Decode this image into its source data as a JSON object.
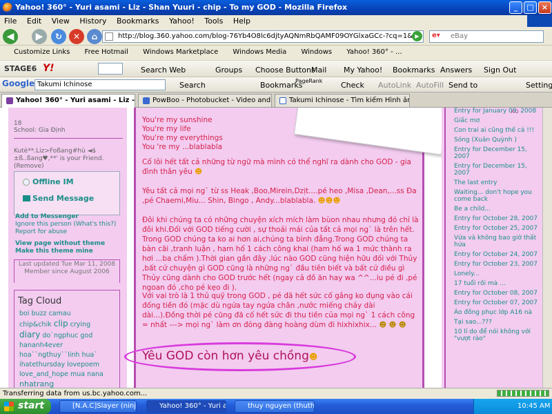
{
  "window": {
    "title": "Yahoo! 360° - Yuri asami - Liz - Shan Yuuri - chip - To my GOD - Mozilla Firefox"
  },
  "menu": [
    "File",
    "Edit",
    "View",
    "History",
    "Bookmarks",
    "Yahoo!",
    "Tools",
    "Help"
  ],
  "nav": {
    "url": "http://blog.360.yahoo.com/blog-76Yb4O8lc6djtyAQNmRbQAMF09OYGlxaGCc-?cq=1&p=140",
    "search_placeholder": "eBay"
  },
  "bookmarks": [
    "Customize Links",
    "Free Hotmail",
    "Windows Marketplace",
    "Windows Media",
    "Windows",
    "Yahoo! 360° - ..."
  ],
  "toolbar1": {
    "brand": "STAGE6",
    "search_web": "Search Web",
    "groups": "Groups",
    "choose_buttons": "Choose Buttons",
    "mail": "Mail",
    "my_yahoo": "My Yahoo!",
    "bookmarks": "Bookmarks",
    "answers": "Answers",
    "sign_out": "Sign Out"
  },
  "toolbar2": {
    "google": "Google",
    "query": "Takumi Ichinose",
    "search": "Search",
    "bookmarks": "Bookmarks",
    "pagerank": "PageRank",
    "check": "Check",
    "autolink": "AutoLink",
    "autofill": "AutoFill",
    "send_to": "Send to",
    "settings": "Settings"
  },
  "tabs": [
    "Yahoo! 360° - Yuri asami - Liz - S...",
    "PowBoo - Photobucket - Video and Im...",
    "Takumi Ichinose - Tìm kiếm Hình ảnh G..."
  ],
  "left": {
    "age": "18",
    "school": "School: Gia Định",
    "friend_line": "Kutè**.Liz>Foßang#hù ◄$±ß..ßang♥,**' is your Friend. (Remove)",
    "offline_im": "Offline IM",
    "send_message": "Send Message",
    "links": [
      "Add to Messenger",
      "Ignore this person (What's this?)",
      "Report for abuse"
    ],
    "bold_links": [
      "View page without theme",
      "Make this theme mine"
    ],
    "last_updated": "Last updated Tue Mar 11, 2008",
    "member_since": "Member since August 2006",
    "tag_cloud_title": "Tag Cloud",
    "tags": [
      [
        "boi",
        "buzz",
        "camau"
      ],
      [
        "chip&chik",
        "clip",
        "crying"
      ],
      [
        "diary",
        "do`ngphuc",
        "god"
      ],
      [
        "hananh4ever"
      ],
      [
        "hoa``ngthuy``linh",
        "hua`"
      ],
      [
        "ihatethursday",
        "lovepoem"
      ],
      [
        "love_and_hope",
        "mua",
        "nana"
      ],
      [
        "nhatrang"
      ]
    ]
  },
  "main": {
    "lines": [
      "You're my sunshine",
      "You're my life",
      "You're my everythings",
      "You 're my ...blablabla"
    ],
    "p1": "Cố lôi hết tất cả những từ ngữ mà mình có thể nghĩ ra dành cho GOD - gia đình thân yêu",
    "p2": "Yêu tất cả mọi ng` từ ss Heak ,Boo,Mirein,Dzịt....pé heo ,Misa ,Dean,...ss Đa ,pé Chaemi,Miu... Shin, Bingo , Andy...blablabla.",
    "p3": "Đôi khi chúng ta có những chuyện xích mích làm bùon nhau nhưng đó chỉ là đôi khi.Đối với GOD tiếng cười , sự thoải mái của tất cả mọi ng` là trên hết. Trong GOD chúng ta ko ai hơn ai,chúng ta bình đẳng.Trong GOD chúng ta bàn cãi ,tranh luận , ham hố 1 cách công khai (ham hố wa 1 mức thành ra hơi ...ba chấm ).Thời gian gần đây ,lúc nào GOD cũng hiện hữu đối với Thủy ,bất cứ chuyện gì GOD cũng là những ng` đầu tiên biết và bất cứ điều gì Thủy cũng dành cho GOD trước hết (ngay cả đồ ăn hay wa ^^...iu pé đi ,pé ngoan đó ,cho pé kẹo đi ).",
    "p4": "Với vai trò là 1 thủ quỹ trong GOD , pé đã hết sức cố gắng ko đụng vào cái đống tiền đó (mặc dù ngứa tay ngứa chân ,nước miếng chảy dài dài...).Đồng thời pé cũng đã cố hết sức đi thu tiền của mọi ng` 1 cách công = nhất ---> mọi ng` làm ơn đóng đàng hoàng dùm đi hixhixhix...",
    "headline": "Yêu GOD còn hơn yêu chồng"
  },
  "right": {
    "entries": [
      "Entry for January 09, 2008",
      "Giấc mơ",
      "Con trai ai cũng thế cả !!!",
      "Sóng (Xuân Quỳnh )",
      "Entry for December 15, 2007",
      "Entry for December 15, 2007",
      "The last entry",
      "Waiting... don't hope you come back",
      "Be a child...",
      "Entry for October 28, 2007",
      "Entry for October 25, 2007",
      "Vứa và không bao giờ thất hứa",
      "Entry for October 24, 2007",
      "Entry for October 23, 2007",
      "Lonely...",
      "17 tuổi rồi mà ...",
      "Entry for October 08, 2007",
      "Entry for October 07, 2007",
      "Áo đồng phục lớp A16 nà",
      "Tại sao...???",
      "10 lí do để nói không với \"vượt rào\""
    ]
  },
  "status": {
    "text": "Transferring data from us.bc.yahoo.com..."
  },
  "taskbar": {
    "start": "start",
    "items": [
      "[N.A.C]Slayer (ninjaa...",
      "Yahoo! 360° - Yuri as...",
      "thuy nguyen (thuthu..."
    ],
    "clock": "10:45 AM"
  },
  "colors": {
    "page_bg": "#f3ccf0",
    "body_text": "#d6204a",
    "link": "#1a8f87",
    "headline": "#b0105a",
    "ellipse": "#d83adc"
  }
}
